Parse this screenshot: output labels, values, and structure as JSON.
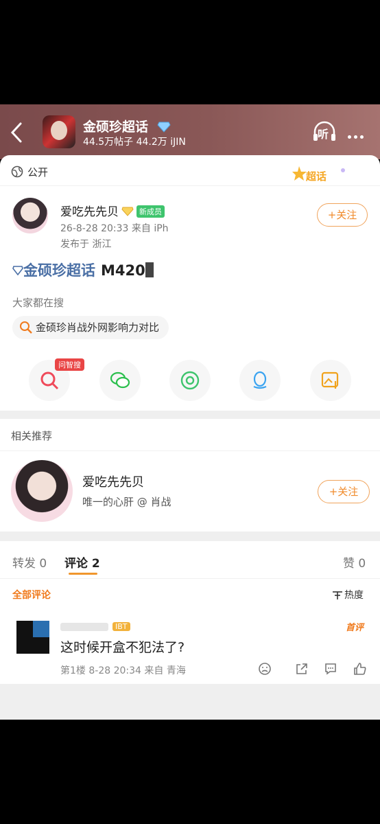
{
  "header": {
    "title": "金硕珍超话",
    "subtitle": "44.5万帖子 44.2万 iJIN",
    "listen_label": "听"
  },
  "post": {
    "visibility": "公开",
    "corner_badge": "超话",
    "author": "爱吃先先贝",
    "author_badge": "新成员",
    "date": "26-8-28 20:33  来自 iPh",
    "location": "发布于 浙江",
    "follow_label": "+关注",
    "topic": "金硕珍超话",
    "topic_rest": "M420",
    "search_heading": "大家都在搜",
    "search_pill": "金硕珍肖战外网影响力对比",
    "share_tag": "问智搜"
  },
  "related": {
    "heading": "相关推荐",
    "name": "爱吃先先贝",
    "desc": "唯一的心肝 @ 肖战",
    "follow_label": "+关注"
  },
  "tabs": {
    "repost": "转发 0",
    "comment": "评论 2",
    "like": "赞 0"
  },
  "comments": {
    "filter_all": "全部评论",
    "sort_label": "热度",
    "items": [
      {
        "badge": "IBT",
        "tag": "首评",
        "text": "这时候开盒不犯法了?",
        "meta": "第1楼 8-28 20:34  来自 青海"
      }
    ]
  },
  "colors": {
    "accent": "#f0962d",
    "topic": "#4a6fa5",
    "header_bg": "#7a4a4b"
  }
}
